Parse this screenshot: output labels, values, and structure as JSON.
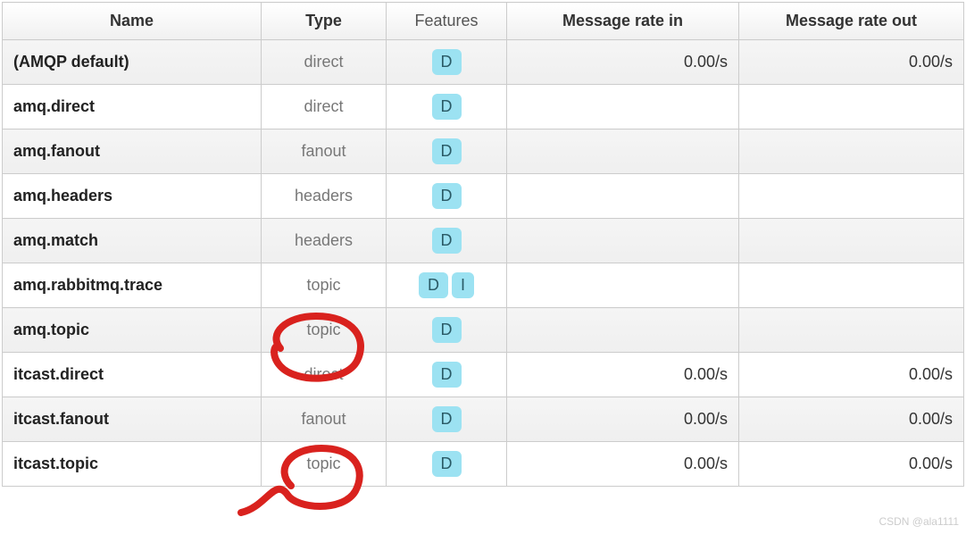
{
  "columns": {
    "name": "Name",
    "type": "Type",
    "features": "Features",
    "rate_in": "Message rate in",
    "rate_out": "Message rate out"
  },
  "rows": [
    {
      "name": "(AMQP default)",
      "type": "direct",
      "features": [
        "D"
      ],
      "rate_in": "0.00/s",
      "rate_out": "0.00/s"
    },
    {
      "name": "amq.direct",
      "type": "direct",
      "features": [
        "D"
      ],
      "rate_in": "",
      "rate_out": ""
    },
    {
      "name": "amq.fanout",
      "type": "fanout",
      "features": [
        "D"
      ],
      "rate_in": "",
      "rate_out": ""
    },
    {
      "name": "amq.headers",
      "type": "headers",
      "features": [
        "D"
      ],
      "rate_in": "",
      "rate_out": ""
    },
    {
      "name": "amq.match",
      "type": "headers",
      "features": [
        "D"
      ],
      "rate_in": "",
      "rate_out": ""
    },
    {
      "name": "amq.rabbitmq.trace",
      "type": "topic",
      "features": [
        "D",
        "I"
      ],
      "rate_in": "",
      "rate_out": ""
    },
    {
      "name": "amq.topic",
      "type": "topic",
      "features": [
        "D"
      ],
      "rate_in": "",
      "rate_out": ""
    },
    {
      "name": "itcast.direct",
      "type": "direct",
      "features": [
        "D"
      ],
      "rate_in": "0.00/s",
      "rate_out": "0.00/s"
    },
    {
      "name": "itcast.fanout",
      "type": "fanout",
      "features": [
        "D"
      ],
      "rate_in": "0.00/s",
      "rate_out": "0.00/s"
    },
    {
      "name": "itcast.topic",
      "type": "topic",
      "features": [
        "D"
      ],
      "rate_in": "0.00/s",
      "rate_out": "0.00/s"
    }
  ],
  "watermark": "CSDN @ala1111"
}
